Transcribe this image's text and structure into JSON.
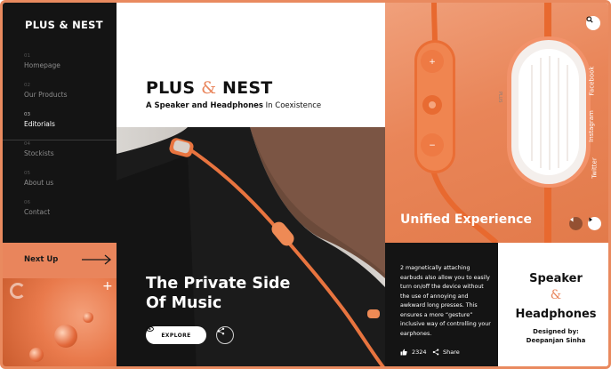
{
  "brand": "PLUS & NEST",
  "nav": [
    {
      "num": "01",
      "label": "Homepage",
      "active": false
    },
    {
      "num": "02",
      "label": "Our Products",
      "active": false
    },
    {
      "num": "03",
      "label": "Editorials",
      "active": true
    },
    {
      "num": "04",
      "label": "Stockists",
      "active": false
    },
    {
      "num": "05",
      "label": "About us",
      "active": false
    },
    {
      "num": "06",
      "label": "Contact",
      "active": false
    }
  ],
  "next_up": {
    "label": "Next Up"
  },
  "hero": {
    "title_part1": "PLUS ",
    "title_amp": "&",
    "title_part2": " NEST",
    "subtitle_bold": "A Speaker and Headphones",
    "subtitle_rest": " In Coexistence"
  },
  "feature": {
    "title_line1": "The Private Side",
    "title_line2": "Of Music",
    "explore_label": "EXPLORE"
  },
  "product": {
    "caption": "Unified Experience",
    "social": [
      "Facebook",
      "Instagram",
      "Twitter"
    ],
    "device_text": "PLUS"
  },
  "description": {
    "text": "2 magnetically attaching earbuds also allow you to easily turn on/off the device without the use of annoying and awkward long presses. This ensures a more “gesture” inclusive way of controlling your earphones.",
    "likes": "2324",
    "share_label": "Share"
  },
  "spec": {
    "word1": "Speaker",
    "amp": "&",
    "word2": "Headphones",
    "designed_by": "Designed by:",
    "designer": "Deepanjan Sinha"
  },
  "colors": {
    "accent": "#e9855c",
    "dark": "#141414"
  }
}
